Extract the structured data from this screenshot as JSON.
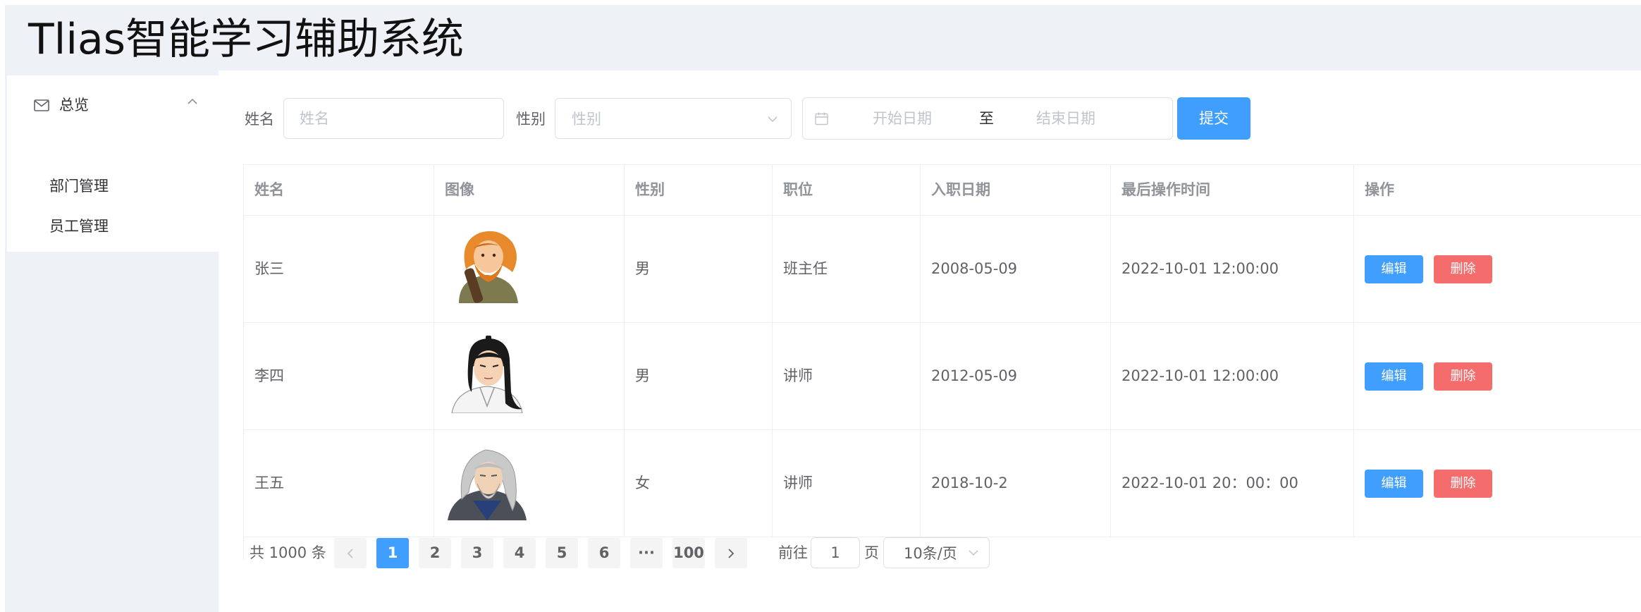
{
  "app": {
    "title": "Tlias智能学习辅助系统"
  },
  "sidebar": {
    "group_label": "总览",
    "items": [
      {
        "label": "部门管理"
      },
      {
        "label": "员工管理"
      }
    ]
  },
  "search": {
    "name_label": "姓名",
    "name_placeholder": "姓名",
    "gender_label": "性别",
    "gender_placeholder": "性别",
    "start_placeholder": "开始日期",
    "range_separator": "至",
    "end_placeholder": "结束日期",
    "submit_label": "提交"
  },
  "table": {
    "columns": [
      "姓名",
      "图像",
      "性别",
      "职位",
      "入职日期",
      "最后操作时间",
      "操作"
    ],
    "rows": [
      {
        "name": "张三",
        "avatar": "orange-haired-warrior",
        "gender": "男",
        "position": "班主任",
        "entry_date": "2008-05-09",
        "update_time": "2022-10-01 12:00:00",
        "edit": "编辑",
        "delete": "删除"
      },
      {
        "name": "李四",
        "avatar": "black-haired-swordsman",
        "gender": "男",
        "position": "讲师",
        "entry_date": "2012-05-09",
        "update_time": "2022-10-01 12:00:00",
        "edit": "编辑",
        "delete": "删除"
      },
      {
        "name": "王五",
        "avatar": "grey-haired-elder",
        "gender": "女",
        "position": "讲师",
        "entry_date": "2018-10-2",
        "update_time": "2022-10-01 20：00：00",
        "edit": "编辑",
        "delete": "删除"
      }
    ]
  },
  "pagination": {
    "total_text": "共 1000 条",
    "prev_icon": "chevron-left-icon",
    "next_icon": "chevron-right-icon",
    "pages": [
      "1",
      "2",
      "3",
      "4",
      "5",
      "6",
      "···",
      "100"
    ],
    "current_page": "1",
    "goto_prefix": "前往",
    "goto_value": "1",
    "goto_suffix": "页",
    "page_size": "10条/页"
  },
  "colors": {
    "primary": "#409eff",
    "danger": "#f56c6c",
    "header_bg": "#eef1f6"
  }
}
